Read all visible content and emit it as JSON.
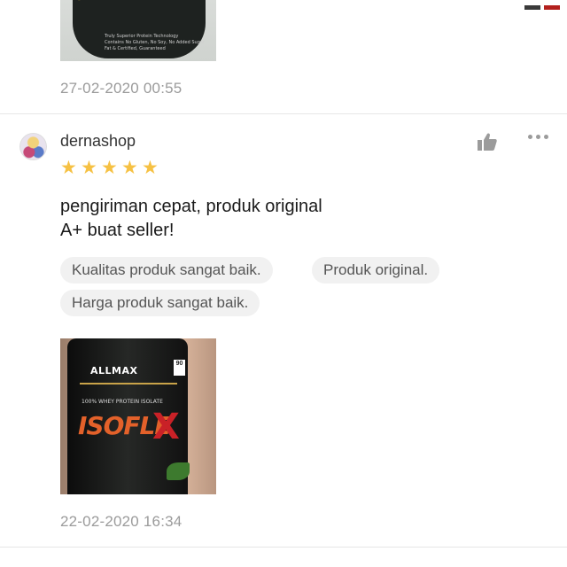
{
  "previous_review": {
    "photo_lines": [
      "Truly Superior Protein Technology",
      "Contains No Gluten, No Soy, No Added Sugar",
      "Fat & Certified, Guaranteed"
    ],
    "date": "27-02-2020 00:55"
  },
  "review": {
    "username": "dernashop",
    "rating": 5,
    "stars": [
      "★",
      "★",
      "★",
      "★",
      "★"
    ],
    "text_line1": "pengiriman cepat, produk original",
    "text_line2": "A+ buat seller!",
    "tags": [
      "Kualitas produk sangat baik.",
      "Produk original.",
      "Harga produk sangat baik."
    ],
    "photo": {
      "brand": "ALLMAX",
      "subtitle": "100% WHEY PROTEIN ISOLATE",
      "product": "ISOFLE",
      "product_x": "X",
      "badge": "90"
    },
    "date": "22-02-2020 16:34"
  },
  "colors": {
    "star": "#f6c143",
    "date_text": "#9b9b9b",
    "tag_bg": "#f1f1f1",
    "divider": "#e6e6e6"
  },
  "icons": {
    "like": "thumbs-up-icon",
    "more": "more-options-icon"
  }
}
